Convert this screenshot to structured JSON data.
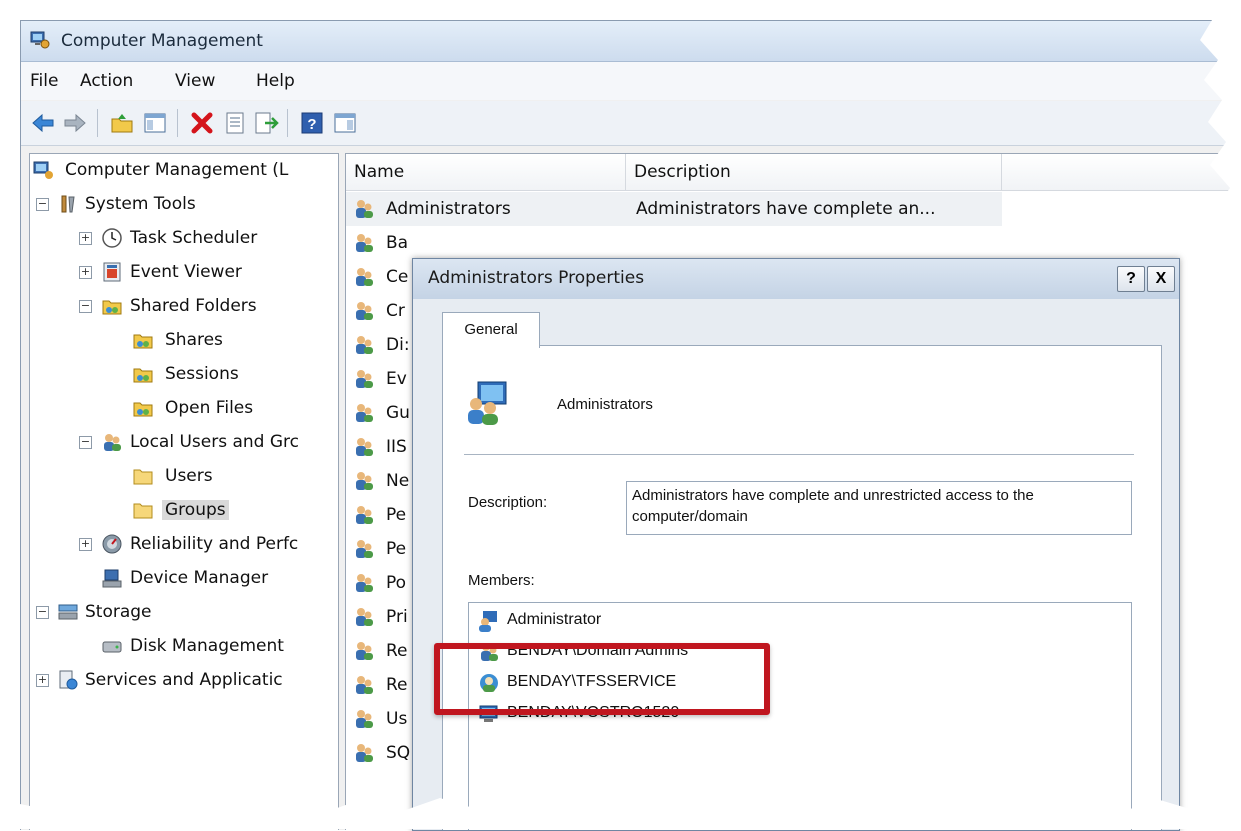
{
  "window": {
    "title": "Computer Management",
    "icon": "computer-management-icon"
  },
  "menu": [
    "File",
    "Action",
    "View",
    "Help"
  ],
  "toolbar": {
    "icons": [
      "back-arrow-icon",
      "forward-arrow-icon",
      "up-folder-icon",
      "show-hide-tree-icon",
      "delete-icon",
      "properties-icon",
      "export-list-icon",
      "help-icon",
      "show-hide-action-pane-icon"
    ]
  },
  "tree": {
    "root": "Computer Management (L",
    "system_tools": "System Tools",
    "task_scheduler": "Task Scheduler",
    "event_viewer": "Event Viewer",
    "shared_folders": "Shared Folders",
    "shares": "Shares",
    "sessions": "Sessions",
    "open_files": "Open Files",
    "local_users": "Local Users and Grc",
    "users": "Users",
    "groups": "Groups",
    "reliability": "Reliability and Perfc",
    "device_manager": "Device Manager",
    "storage": "Storage",
    "disk_management": "Disk Management",
    "services": "Services and Applicatic"
  },
  "list": {
    "columns": [
      "Name",
      "Description"
    ],
    "first_row": {
      "name": "Administrators",
      "description": "Administrators have complete an..."
    },
    "partial_names": [
      "Ba",
      "Ce",
      "Cr",
      "Di:",
      "Ev",
      "Gu",
      "IIS",
      "Ne",
      "Pe",
      "Pe",
      "Po",
      "Pri",
      "Re",
      "Re",
      "Us",
      "SQ"
    ]
  },
  "dialog": {
    "title": "Administrators Properties",
    "help_button": "?",
    "close_button": "X",
    "tab": "General",
    "group_name": "Administrators",
    "description_label": "Description:",
    "description_value": "Administrators have complete and unrestricted access to the computer/domain",
    "members_label": "Members:",
    "members": [
      "Administrator",
      "BENDAY\\Domain Admins",
      "BENDAY\\TFSSERVICE",
      "BENDAY\\VOSTRO1520"
    ]
  },
  "annotation": {
    "highlight_color": "#c0161f"
  }
}
